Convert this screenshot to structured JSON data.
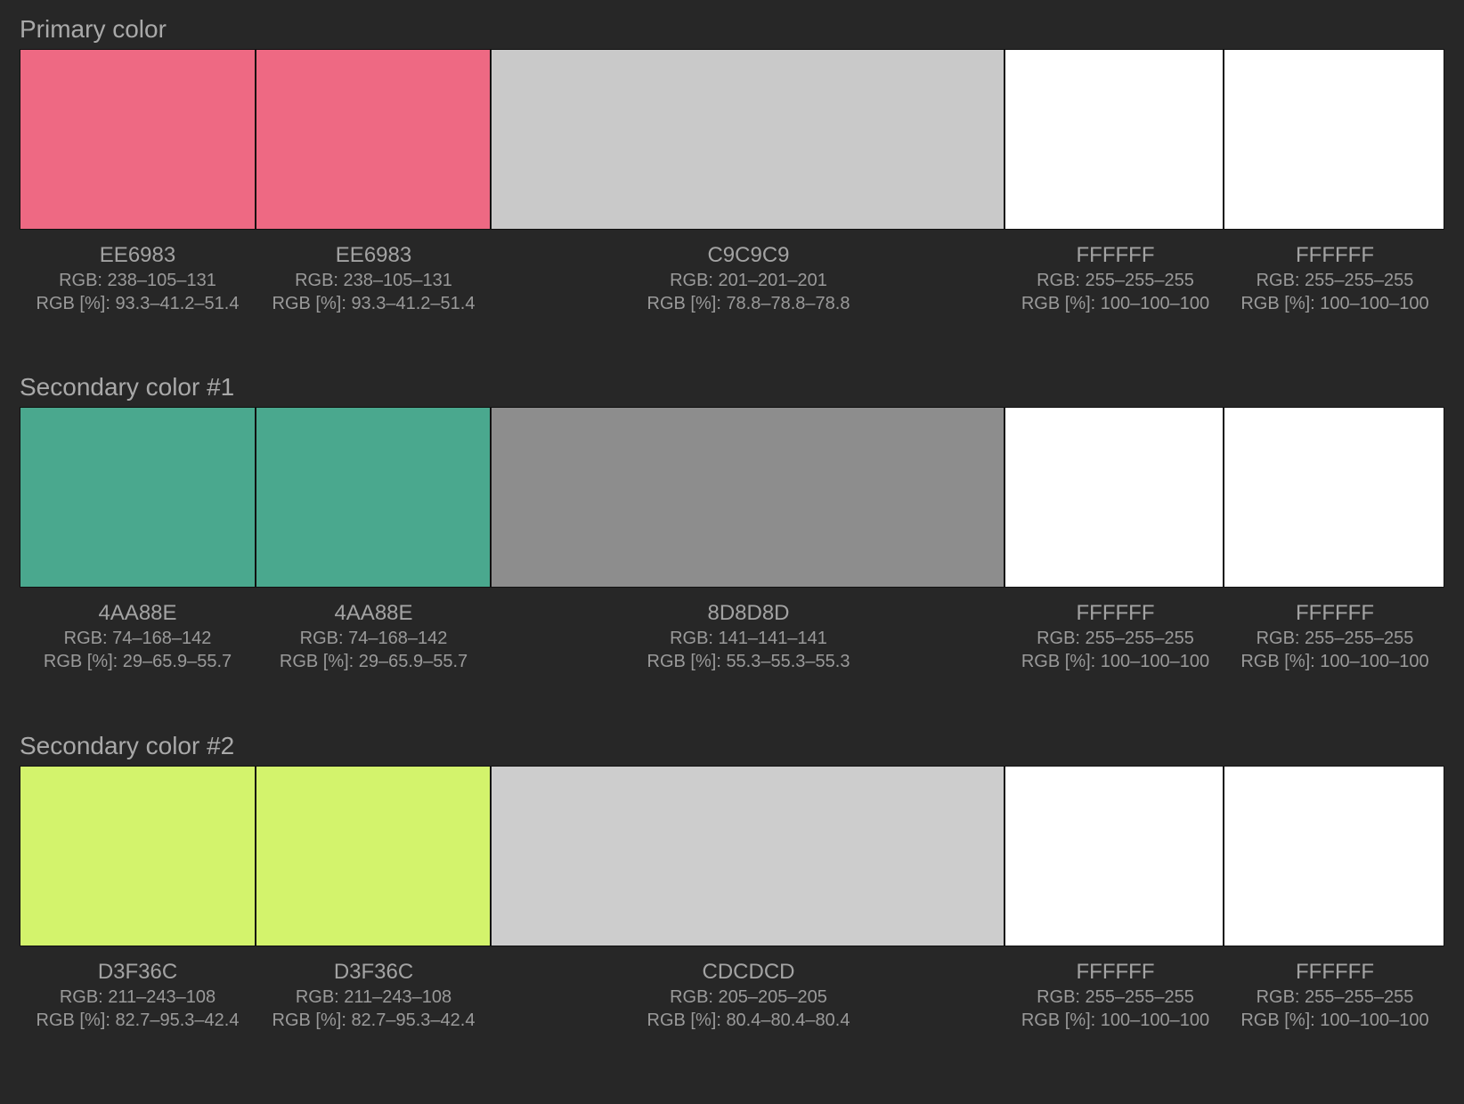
{
  "sections": [
    {
      "title": "Primary color",
      "swatches": [
        {
          "hex": "EE6983",
          "color": "#EE6983",
          "rgb": "RGB: 238–105–131",
          "rgb_pct": "RGB [%]: 93.3–41.2–51.4"
        },
        {
          "hex": "EE6983",
          "color": "#EE6983",
          "rgb": "RGB: 238–105–131",
          "rgb_pct": "RGB [%]: 93.3–41.2–51.4"
        },
        {
          "hex": "C9C9C9",
          "color": "#C9C9C9",
          "rgb": "RGB: 201–201–201",
          "rgb_pct": "RGB [%]: 78.8–78.8–78.8"
        },
        {
          "hex": "FFFFFF",
          "color": "#FFFFFF",
          "rgb": "RGB: 255–255–255",
          "rgb_pct": "RGB [%]: 100–100–100"
        },
        {
          "hex": "FFFFFF",
          "color": "#FFFFFF",
          "rgb": "RGB: 255–255–255",
          "rgb_pct": "RGB [%]: 100–100–100"
        }
      ]
    },
    {
      "title": "Secondary color #1",
      "swatches": [
        {
          "hex": "4AA88E",
          "color": "#4AA88E",
          "rgb": "RGB: 74–168–142",
          "rgb_pct": "RGB [%]: 29–65.9–55.7"
        },
        {
          "hex": "4AA88E",
          "color": "#4AA88E",
          "rgb": "RGB: 74–168–142",
          "rgb_pct": "RGB [%]: 29–65.9–55.7"
        },
        {
          "hex": "8D8D8D",
          "color": "#8D8D8D",
          "rgb": "RGB: 141–141–141",
          "rgb_pct": "RGB [%]: 55.3–55.3–55.3"
        },
        {
          "hex": "FFFFFF",
          "color": "#FFFFFF",
          "rgb": "RGB: 255–255–255",
          "rgb_pct": "RGB [%]: 100–100–100"
        },
        {
          "hex": "FFFFFF",
          "color": "#FFFFFF",
          "rgb": "RGB: 255–255–255",
          "rgb_pct": "RGB [%]: 100–100–100"
        }
      ]
    },
    {
      "title": "Secondary color #2",
      "swatches": [
        {
          "hex": "D3F36C",
          "color": "#D3F36C",
          "rgb": "RGB: 211–243–108",
          "rgb_pct": "RGB [%]: 82.7–95.3–42.4"
        },
        {
          "hex": "D3F36C",
          "color": "#D3F36C",
          "rgb": "RGB: 211–243–108",
          "rgb_pct": "RGB [%]: 82.7–95.3–42.4"
        },
        {
          "hex": "CDCDCD",
          "color": "#CDCDCD",
          "rgb": "RGB: 205–205–205",
          "rgb_pct": "RGB [%]: 80.4–80.4–80.4"
        },
        {
          "hex": "FFFFFF",
          "color": "#FFFFFF",
          "rgb": "RGB: 255–255–255",
          "rgb_pct": "RGB [%]: 100–100–100"
        },
        {
          "hex": "FFFFFF",
          "color": "#FFFFFF",
          "rgb": "RGB: 255–255–255",
          "rgb_pct": "RGB [%]: 100–100–100"
        }
      ]
    }
  ]
}
